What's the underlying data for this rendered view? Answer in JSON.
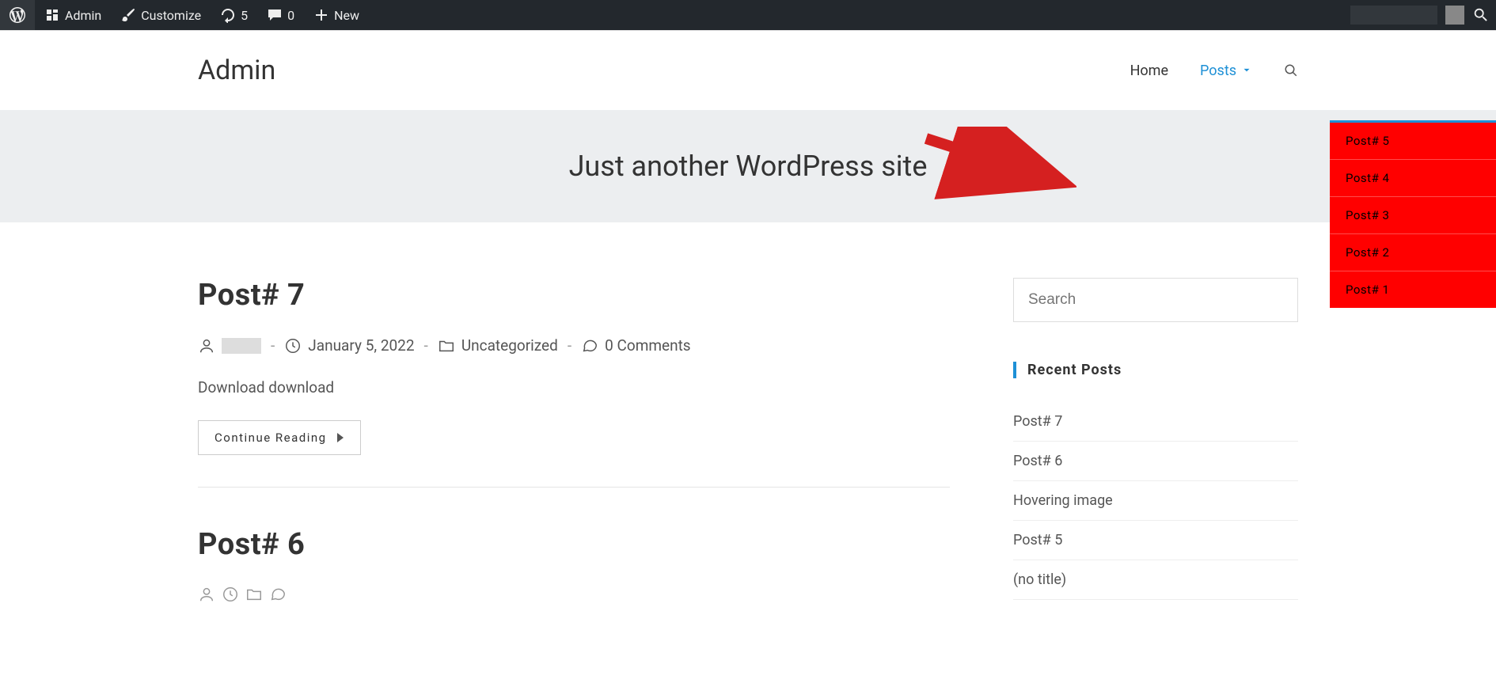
{
  "admin_bar": {
    "admin": "Admin",
    "customize": "Customize",
    "updates": "5",
    "comments": "0",
    "new": "New"
  },
  "header": {
    "site_title": "Admin",
    "nav_home": "Home",
    "nav_posts": "Posts"
  },
  "dropdown": {
    "items": [
      {
        "label": "Post# 5"
      },
      {
        "label": "Post# 4"
      },
      {
        "label": "Post# 3"
      },
      {
        "label": "Post# 2"
      },
      {
        "label": "Post# 1"
      }
    ]
  },
  "tagline": "Just another WordPress site",
  "posts": [
    {
      "title": "Post# 7",
      "date": "January 5, 2022",
      "category": "Uncategorized",
      "comments": "0 Comments",
      "excerpt": "Download download",
      "continue": "Continue Reading"
    },
    {
      "title": "Post# 6"
    }
  ],
  "sidebar": {
    "search_placeholder": "Search",
    "recent_title": "Recent Posts",
    "recent": [
      {
        "label": "Post# 7"
      },
      {
        "label": "Post# 6"
      },
      {
        "label": "Hovering image"
      },
      {
        "label": "Post# 5"
      },
      {
        "label": "(no title)"
      }
    ]
  }
}
